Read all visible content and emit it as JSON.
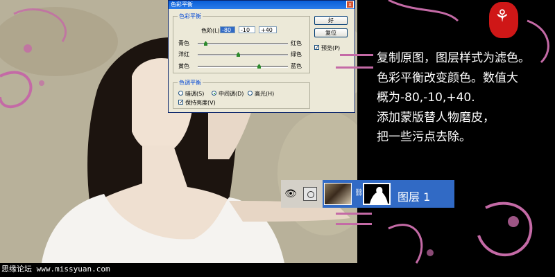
{
  "dialog": {
    "title": "色彩平衡",
    "close_label": "x",
    "color_balance_group": "色彩平衡",
    "levels_label": "色阶(L):",
    "levels_values": [
      "-80",
      "-10",
      "+40"
    ],
    "sliders": [
      {
        "left_label": "青色",
        "right_label": "红色",
        "value": -80
      },
      {
        "left_label": "洋红",
        "right_label": "绿色",
        "value": -10
      },
      {
        "left_label": "黄色",
        "right_label": "蓝色",
        "value": 40
      }
    ],
    "tone_group": "色调平衡",
    "tone_options": [
      "暗调(S)",
      "中间调(D)",
      "高光(H)"
    ],
    "tone_selected": "中间调(D)",
    "preserve_label": "保持亮度(V)",
    "ok_label": "好",
    "reset_label": "复位",
    "preview_label": "预览(P)",
    "preview_checked": true,
    "preserve_checked": true
  },
  "layers": {
    "eye_icon": "eye-icon",
    "layer_name": "图层 1"
  },
  "notes": [
    "复制原图，图层样式为滤色。",
    "色彩平衡改变颜色。数值大",
    "概为-80,-10,+40.",
    "添加蒙版替人物磨皮，",
    "把一些污点去除。"
  ],
  "watermark": "思缘论坛 www.missyuan.com",
  "colors": {
    "accent_pink": "#c46aa6",
    "seal_red": "#cf1717",
    "layer_selected": "#316ac5"
  }
}
